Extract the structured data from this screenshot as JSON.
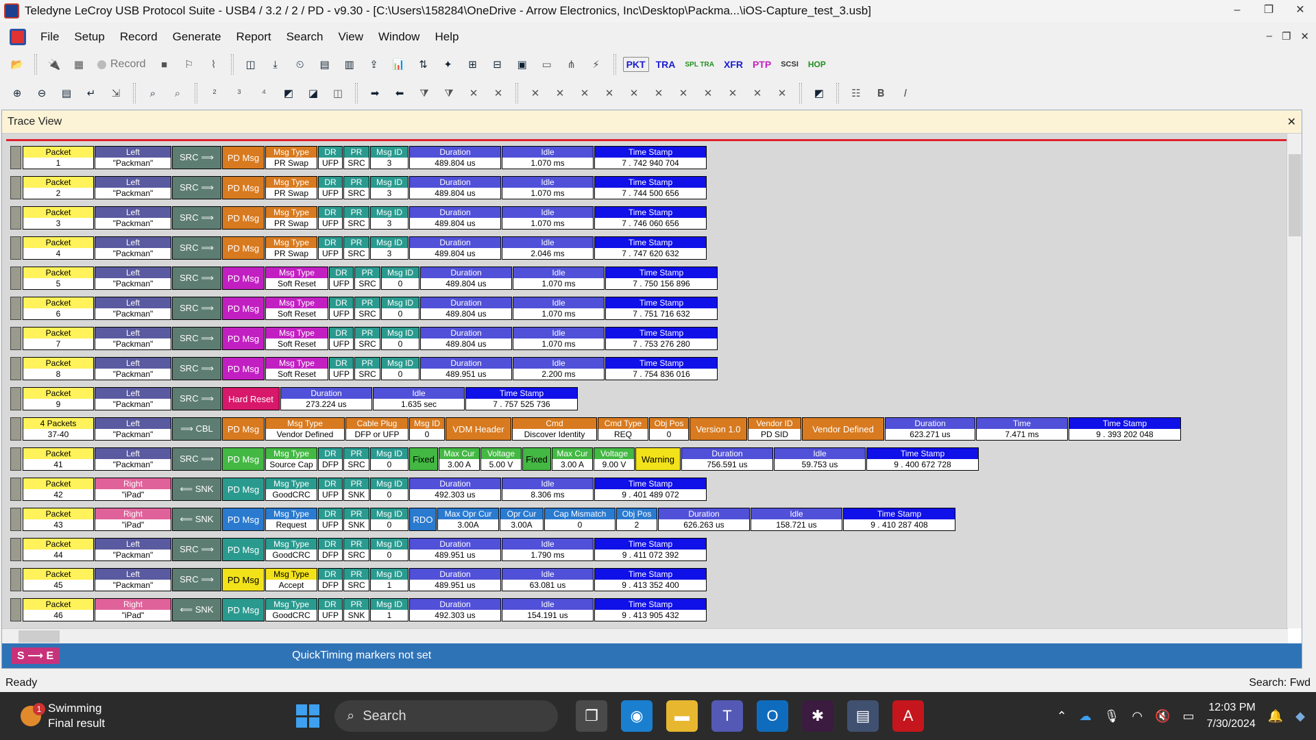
{
  "window": {
    "title": "Teledyne LeCroy USB Protocol Suite - USB4 / 3.2 / 2 / PD - v9.30 - [C:\\Users\\158284\\OneDrive - Arrow Electronics, Inc\\Desktop\\Packma...\\iOS-Capture_test_3.usb]",
    "min": "–",
    "restore": "❐",
    "close": "✕"
  },
  "menu": [
    "File",
    "Setup",
    "Record",
    "Generate",
    "Report",
    "Search",
    "View",
    "Window",
    "Help"
  ],
  "mdi": {
    "min": "–",
    "restore": "❐",
    "close": "✕"
  },
  "toolbar": {
    "record_label": "Record",
    "protocols": [
      "PKT",
      "TRA",
      "SPL TRA",
      "XFR",
      "PTP",
      "SCSI",
      "HOP"
    ]
  },
  "traceview": {
    "title": "Trace View",
    "close": "✕"
  },
  "labels": {
    "packet": "Packet",
    "duration": "Duration",
    "idle": "Idle",
    "time_stamp": "Time Stamp",
    "time": "Time",
    "msg_type": "Msg Type",
    "dr": "DR",
    "pr": "PR",
    "msg_id": "Msg ID",
    "pd_msg": "PD Msg",
    "src": "SRC",
    "snk": "SNK",
    "cbl": "CBL",
    "hard_reset": "Hard Reset",
    "rdo": "RDO",
    "fixed": "Fixed",
    "max_cur": "Max Cur",
    "voltage": "Voltage",
    "warning": "Warning",
    "cable_plug": "Cable Plug",
    "vdm_header": "VDM Header",
    "cmd": "Cmd",
    "cmd_type": "Cmd Type",
    "obj_pos": "Obj Pos",
    "version": "Version 1.0",
    "vendor_id": "Vendor ID",
    "vendor_defined": "Vendor Defined",
    "max_opr_cur": "Max Opr Cur",
    "opr_cur": "Opr Cur",
    "cap_mismatch": "Cap Mismatch"
  },
  "packets": [
    {
      "num": "1",
      "dir": "Left",
      "dev": "\"Packman\"",
      "type": "PR Swap",
      "dr": "UFP",
      "pr": "SRC",
      "id": "3",
      "dur": "489.804 us",
      "idle": "1.070 ms",
      "ts": "7 . 742 940 704"
    },
    {
      "num": "2",
      "dir": "Left",
      "dev": "\"Packman\"",
      "type": "PR Swap",
      "dr": "UFP",
      "pr": "SRC",
      "id": "3",
      "dur": "489.804 us",
      "idle": "1.070 ms",
      "ts": "7 . 744 500 656"
    },
    {
      "num": "3",
      "dir": "Left",
      "dev": "\"Packman\"",
      "type": "PR Swap",
      "dr": "UFP",
      "pr": "SRC",
      "id": "3",
      "dur": "489.804 us",
      "idle": "1.070 ms",
      "ts": "7 . 746 060 656"
    },
    {
      "num": "4",
      "dir": "Left",
      "dev": "\"Packman\"",
      "type": "PR Swap",
      "dr": "UFP",
      "pr": "SRC",
      "id": "3",
      "dur": "489.804 us",
      "idle": "2.046 ms",
      "ts": "7 . 747 620 632"
    },
    {
      "num": "5",
      "dir": "Left",
      "dev": "\"Packman\"",
      "type": "Soft Reset",
      "dr": "UFP",
      "pr": "SRC",
      "id": "0",
      "dur": "489.804 us",
      "idle": "1.070 ms",
      "ts": "7 . 750 156 896"
    },
    {
      "num": "6",
      "dir": "Left",
      "dev": "\"Packman\"",
      "type": "Soft Reset",
      "dr": "UFP",
      "pr": "SRC",
      "id": "0",
      "dur": "489.804 us",
      "idle": "1.070 ms",
      "ts": "7 . 751 716 632"
    },
    {
      "num": "7",
      "dir": "Left",
      "dev": "\"Packman\"",
      "type": "Soft Reset",
      "dr": "UFP",
      "pr": "SRC",
      "id": "0",
      "dur": "489.804 us",
      "idle": "1.070 ms",
      "ts": "7 . 753 276 280"
    },
    {
      "num": "8",
      "dir": "Left",
      "dev": "\"Packman\"",
      "type": "Soft Reset",
      "dr": "UFP",
      "pr": "SRC",
      "id": "0",
      "dur": "489.951 us",
      "idle": "2.200 ms",
      "ts": "7 . 754 836 016"
    },
    {
      "num": "9",
      "dir": "Left",
      "dev": "\"Packman\"",
      "dur": "273.224 us",
      "idle": "1.635 sec",
      "ts": "7 . 757 525 736"
    },
    {
      "num": "37-40",
      "hdr": "4 Packets",
      "dir": "Left",
      "dev": "\"Packman\"",
      "type": "Vendor Defined",
      "cable": "DFP or UFP",
      "id": "0",
      "cmd": "Discover Identity",
      "cmdtype": "REQ",
      "objpos": "0",
      "vid": "PD SID",
      "dur": "623.271 us",
      "time": "7.471 ms",
      "ts": "9 . 393 202 048"
    },
    {
      "num": "41",
      "dir": "Left",
      "dev": "\"Packman\"",
      "type": "Source Cap",
      "dr": "DFP",
      "pr": "SRC",
      "id": "0",
      "c1": "3.00 A",
      "v1": "5.00 V",
      "c2": "3.00 A",
      "v2": "9.00 V",
      "dur": "756.591 us",
      "idle": "59.753 us",
      "ts": "9 . 400 672 728"
    },
    {
      "num": "42",
      "dir": "Right",
      "dev": "\"iPad\"",
      "type": "GoodCRC",
      "dr": "UFP",
      "pr": "SNK",
      "id": "0",
      "dur": "492.303 us",
      "idle": "8.306 ms",
      "ts": "9 . 401 489 072"
    },
    {
      "num": "43",
      "dir": "Right",
      "dev": "\"iPad\"",
      "type": "Request",
      "dr": "UFP",
      "pr": "SNK",
      "id": "0",
      "maxopr": "3.00A",
      "opr": "3.00A",
      "mis": "0",
      "objpos": "2",
      "dur": "626.263 us",
      "idle": "158.721 us",
      "ts": "9 . 410 287 408"
    },
    {
      "num": "44",
      "dir": "Left",
      "dev": "\"Packman\"",
      "type": "GoodCRC",
      "dr": "DFP",
      "pr": "SRC",
      "id": "0",
      "dur": "489.951 us",
      "idle": "1.790 ms",
      "ts": "9 . 411 072 392"
    },
    {
      "num": "45",
      "dir": "Left",
      "dev": "\"Packman\"",
      "type": "Accept",
      "dr": "DFP",
      "pr": "SRC",
      "id": "1",
      "dur": "489.951 us",
      "idle": "63.081 us",
      "ts": "9 . 413 352 400"
    },
    {
      "num": "46",
      "dir": "Right",
      "dev": "\"iPad\"",
      "type": "GoodCRC",
      "dr": "UFP",
      "pr": "SNK",
      "id": "1",
      "dur": "492.303 us",
      "idle": "154.191 us",
      "ts": "9 . 413 905 432"
    }
  ],
  "quicktiming": {
    "badge": "S ⟶ E",
    "text": "QuickTiming markers not set"
  },
  "status": {
    "left": "Ready",
    "right": "Search: Fwd"
  },
  "taskbar": {
    "weather_title": "Swimming",
    "weather_sub": "Final result",
    "badge": "1",
    "search": "Search",
    "time": "12:03 PM",
    "date": "7/30/2024"
  },
  "colors": {
    "packet": "#fff25a",
    "left": "#5a5aa0",
    "right": "#e0629a",
    "src": "#5d7d72",
    "pd_orange": "#d87a1f",
    "pd_magenta": "#c21fc2",
    "pd_teal": "#2a9a8f",
    "pd_green": "#43b843",
    "pd_blue": "#2a7ad0",
    "pd_yellow": "#f2e21a",
    "dur": "#5050d8",
    "idle": "#5050d8",
    "ts": "#1010e8",
    "hard_reset": "#d8186a",
    "qt": "#2f73b7"
  }
}
